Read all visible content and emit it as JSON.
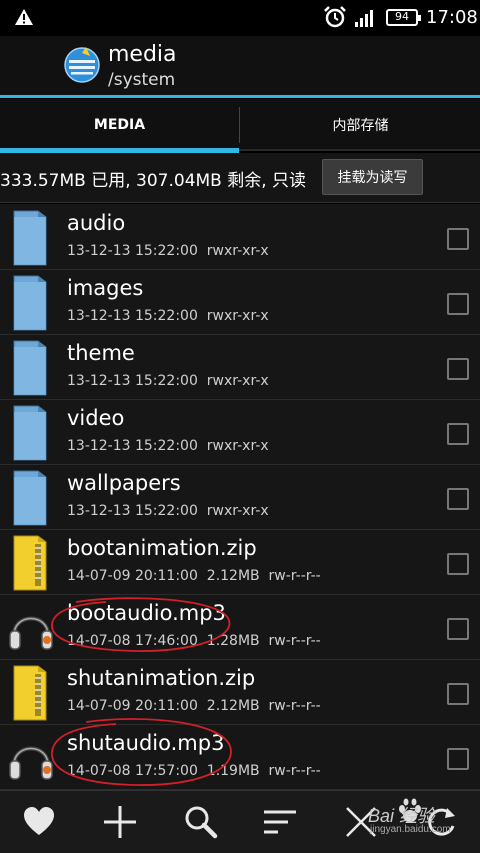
{
  "status_bar": {
    "battery": "94",
    "time": "17:08",
    "icons": [
      "warning-icon",
      "alarm-icon",
      "signal-icon",
      "battery-icon"
    ]
  },
  "header": {
    "title": "media",
    "path": "/system"
  },
  "tabs": [
    {
      "label": "MEDIA",
      "active": true
    },
    {
      "label": "内部存储",
      "active": false
    }
  ],
  "storage": {
    "info": "333.57MB 已用, 307.04MB 剩余, 只读",
    "mount_button": "挂载为读写"
  },
  "files": [
    {
      "name": "audio",
      "date": "13-12-13 15:22:00",
      "size": "",
      "perms": "rwxr-xr-x",
      "type": "folder"
    },
    {
      "name": "images",
      "date": "13-12-13 15:22:00",
      "size": "",
      "perms": "rwxr-xr-x",
      "type": "folder"
    },
    {
      "name": "theme",
      "date": "13-12-13 15:22:00",
      "size": "",
      "perms": "rwxr-xr-x",
      "type": "folder"
    },
    {
      "name": "video",
      "date": "13-12-13 15:22:00",
      "size": "",
      "perms": "rwxr-xr-x",
      "type": "folder"
    },
    {
      "name": "wallpapers",
      "date": "13-12-13 15:22:00",
      "size": "",
      "perms": "rwxr-xr-x",
      "type": "folder"
    },
    {
      "name": "bootanimation.zip",
      "date": "14-07-09 20:11:00",
      "size": "2.12MB",
      "perms": "rw-r--r--",
      "type": "zip"
    },
    {
      "name": "bootaudio.mp3",
      "date": "14-07-08 17:46:00",
      "size": "1.28MB",
      "perms": "rw-r--r--",
      "type": "audio"
    },
    {
      "name": "shutanimation.zip",
      "date": "14-07-09 20:11:00",
      "size": "2.12MB",
      "perms": "rw-r--r--",
      "type": "zip"
    },
    {
      "name": "shutaudio.mp3",
      "date": "14-07-08 17:57:00",
      "size": "1.19MB",
      "perms": "rw-r--r--",
      "type": "audio"
    }
  ],
  "bottom_bar": [
    "favorite-icon",
    "add-icon",
    "search-icon",
    "sort-icon",
    "close-icon",
    "refresh-icon"
  ],
  "watermark": {
    "brand": "Bai 经验",
    "url": "jingyan.baidu.com"
  },
  "colors": {
    "accent": "#33b5e5",
    "folder": "#6fa8d8",
    "zip": "#f2cf2c",
    "annotation": "#d0202a"
  }
}
